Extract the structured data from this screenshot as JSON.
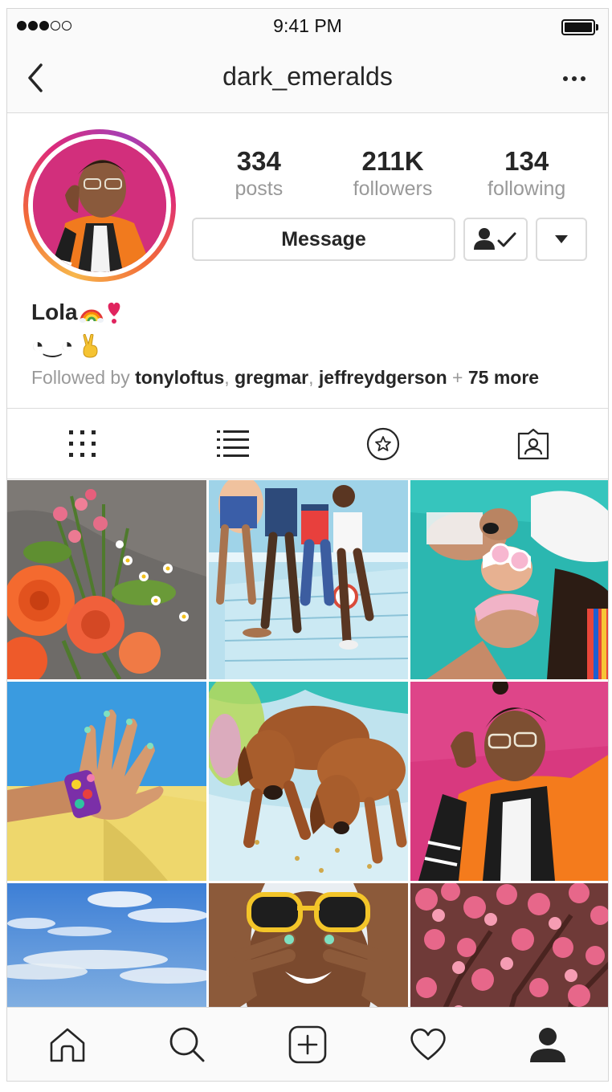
{
  "status_bar": {
    "time": "9:41 PM",
    "signal_bars_filled": 3,
    "signal_bars_total": 5
  },
  "nav": {
    "title": "dark_emeralds",
    "back_icon": "chevron-left-icon",
    "more_icon": "more-horizontal-icon"
  },
  "profile": {
    "stats": [
      {
        "value": "334",
        "label": "posts"
      },
      {
        "value": "211K",
        "label": "followers"
      },
      {
        "value": "134",
        "label": "following"
      }
    ],
    "message_label": "Message",
    "name": "Lola",
    "name_emojis": [
      "rainbow-icon",
      "heart-exclamation-icon"
    ],
    "bio_face": "◔‿◔",
    "bio_emoji": "victory-hand-icon",
    "followed_by_prefix": "Followed by",
    "followed_by_users": [
      "tonyloftus",
      "gregmar",
      "jeffreydgerson"
    ],
    "followed_by_sep": ", ",
    "followed_by_plus": " + ",
    "followed_by_more": "75 more"
  },
  "tabs": [
    "grid-icon",
    "list-icon",
    "saved-star-icon",
    "tagged-icon"
  ],
  "grid": [
    {
      "subject": "flowers-photo"
    },
    {
      "subject": "friends-on-lifeguard-tower-photo"
    },
    {
      "subject": "friends-lying-on-blanket-photo"
    },
    {
      "subject": "hand-with-bracelet-photo"
    },
    {
      "subject": "puppies-photo"
    },
    {
      "subject": "portrait-orange-jacket-photo"
    },
    {
      "subject": "sky-over-lake-photo"
    },
    {
      "subject": "yellow-sunglasses-photo"
    },
    {
      "subject": "pink-blossoms-photo"
    }
  ],
  "bottom_nav": [
    "home-icon",
    "search-icon",
    "new-post-icon",
    "activity-heart-icon",
    "profile-icon"
  ],
  "colors": {
    "ring_gradient": [
      "#f7b64b",
      "#f26b38",
      "#dd2a7b",
      "#a53fb4"
    ],
    "muted_text": "#999999",
    "border": "#dbdbdb"
  }
}
